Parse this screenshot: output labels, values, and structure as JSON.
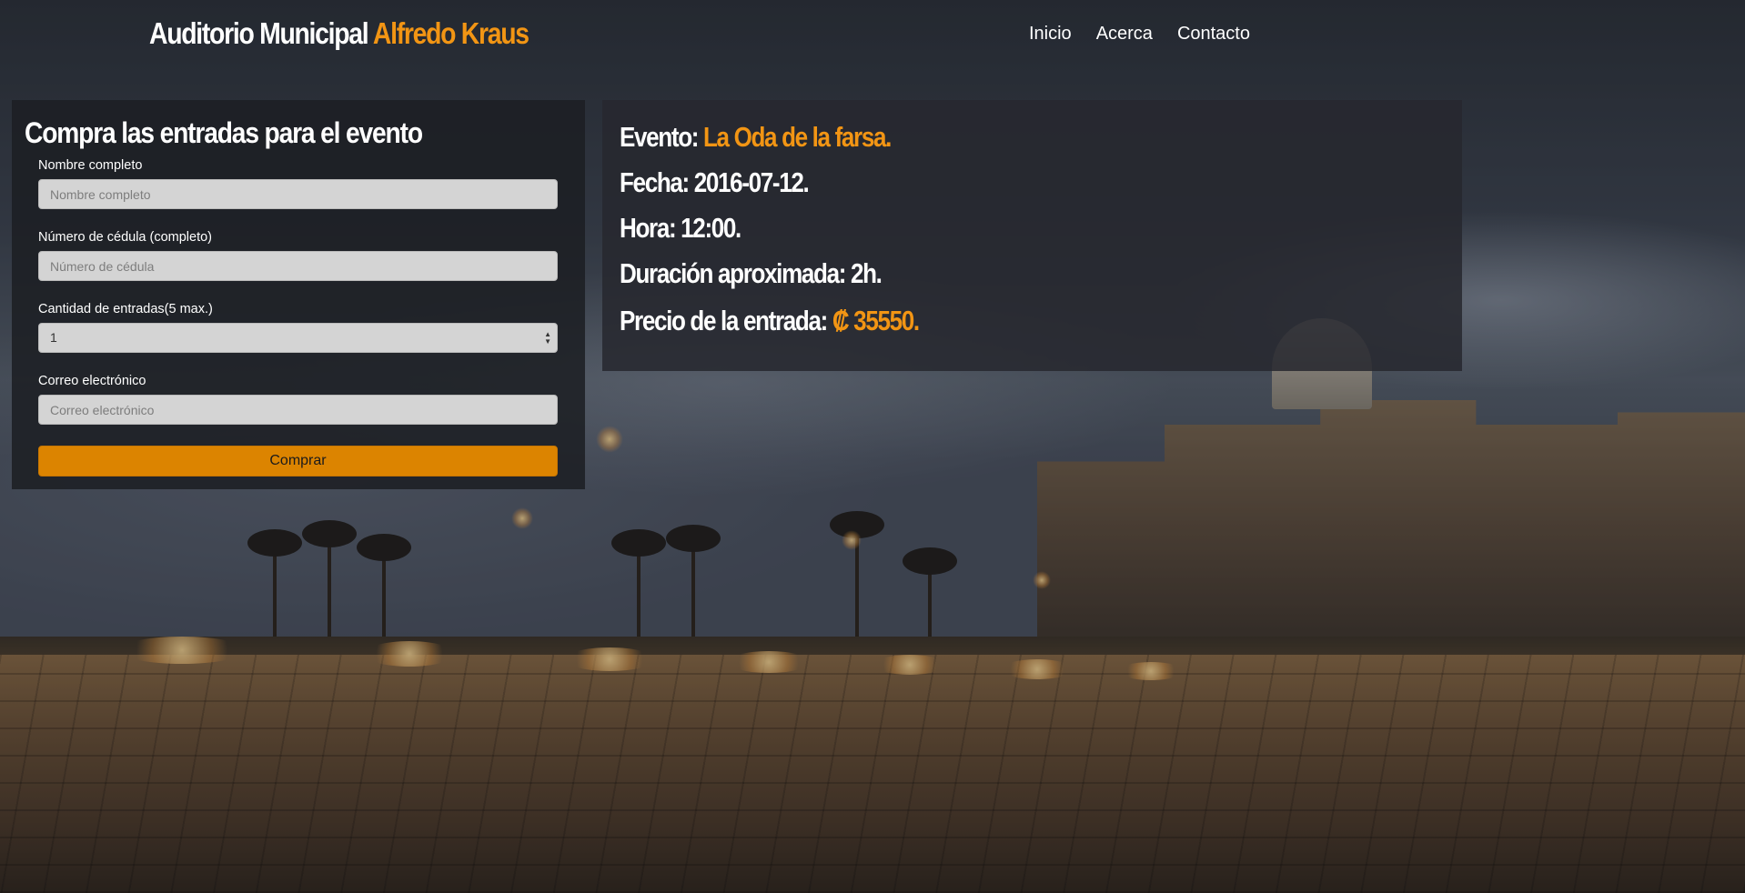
{
  "navbar": {
    "brand_main": "Auditorio Municipal",
    "brand_accent": "Alfredo Kraus",
    "links": [
      "Inicio",
      "Acerca",
      "Contacto"
    ]
  },
  "form": {
    "title": "Compra las entradas para el evento",
    "name": {
      "label": "Nombre completo",
      "placeholder": "Nombre completo"
    },
    "id_number": {
      "label": "Número de cédula (completo)",
      "placeholder": "Número de cédula"
    },
    "quantity": {
      "label": "Cantidad de entradas(5 max.)",
      "value": "1"
    },
    "email": {
      "label": "Correo electrónico",
      "placeholder": "Correo electrónico"
    },
    "submit_label": "Comprar"
  },
  "event": {
    "event_label": "Evento:",
    "event_name": "La Oda de la farsa.",
    "date_label": "Fecha:",
    "date_value": "2016-07-12.",
    "time_label": "Hora:",
    "time_value": "12:00.",
    "duration_label": "Duración aproximada:",
    "duration_value": "2h.",
    "price_label": "Precio de la entrada:",
    "price_value": "₡ 35550."
  },
  "colors": {
    "accent": "#f29514",
    "button": "#dc8400"
  }
}
